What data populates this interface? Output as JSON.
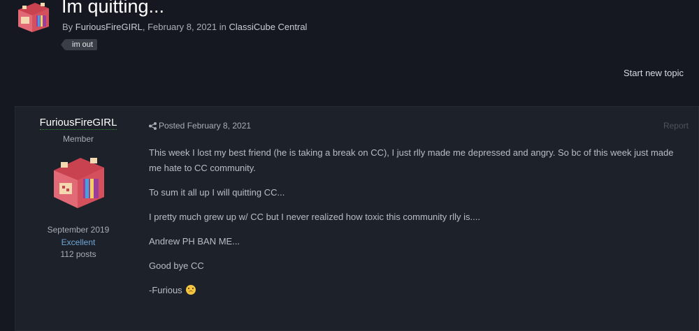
{
  "topic": {
    "title": "Im quitting...",
    "meta_prefix": "By ",
    "author": "FuriousFireGIRL",
    "date": ", February 8, 2021 in ",
    "forum": "ClassiCube Central",
    "tag": "im out",
    "start_new_topic": "Start new topic"
  },
  "post": {
    "author": {
      "name": "FuriousFireGIRL",
      "rank": "Member",
      "joined": "September 2019",
      "reputation": "Excellent",
      "posts": "112 posts"
    },
    "posted": "Posted February 8, 2021",
    "report": "Report",
    "paragraphs": [
      "This week I lost my best friend (he is taking a break on CC), I just rlly made me depressed and angry. So bc of this week just made me hate to CC community.",
      "To sum it all up I will quitting CC...",
      "I pretty much grew up w/ CC but I never realized how toxic this community rlly is....",
      "Andrew PH BAN ME...",
      "Good bye CC",
      "-Furious "
    ],
    "emoji": "disappointed-face-icon"
  },
  "colors": {
    "background": "#151820",
    "post_background": "#1d212a",
    "reputation": "#6ea7d8",
    "avatar_main": "#e0566a"
  }
}
